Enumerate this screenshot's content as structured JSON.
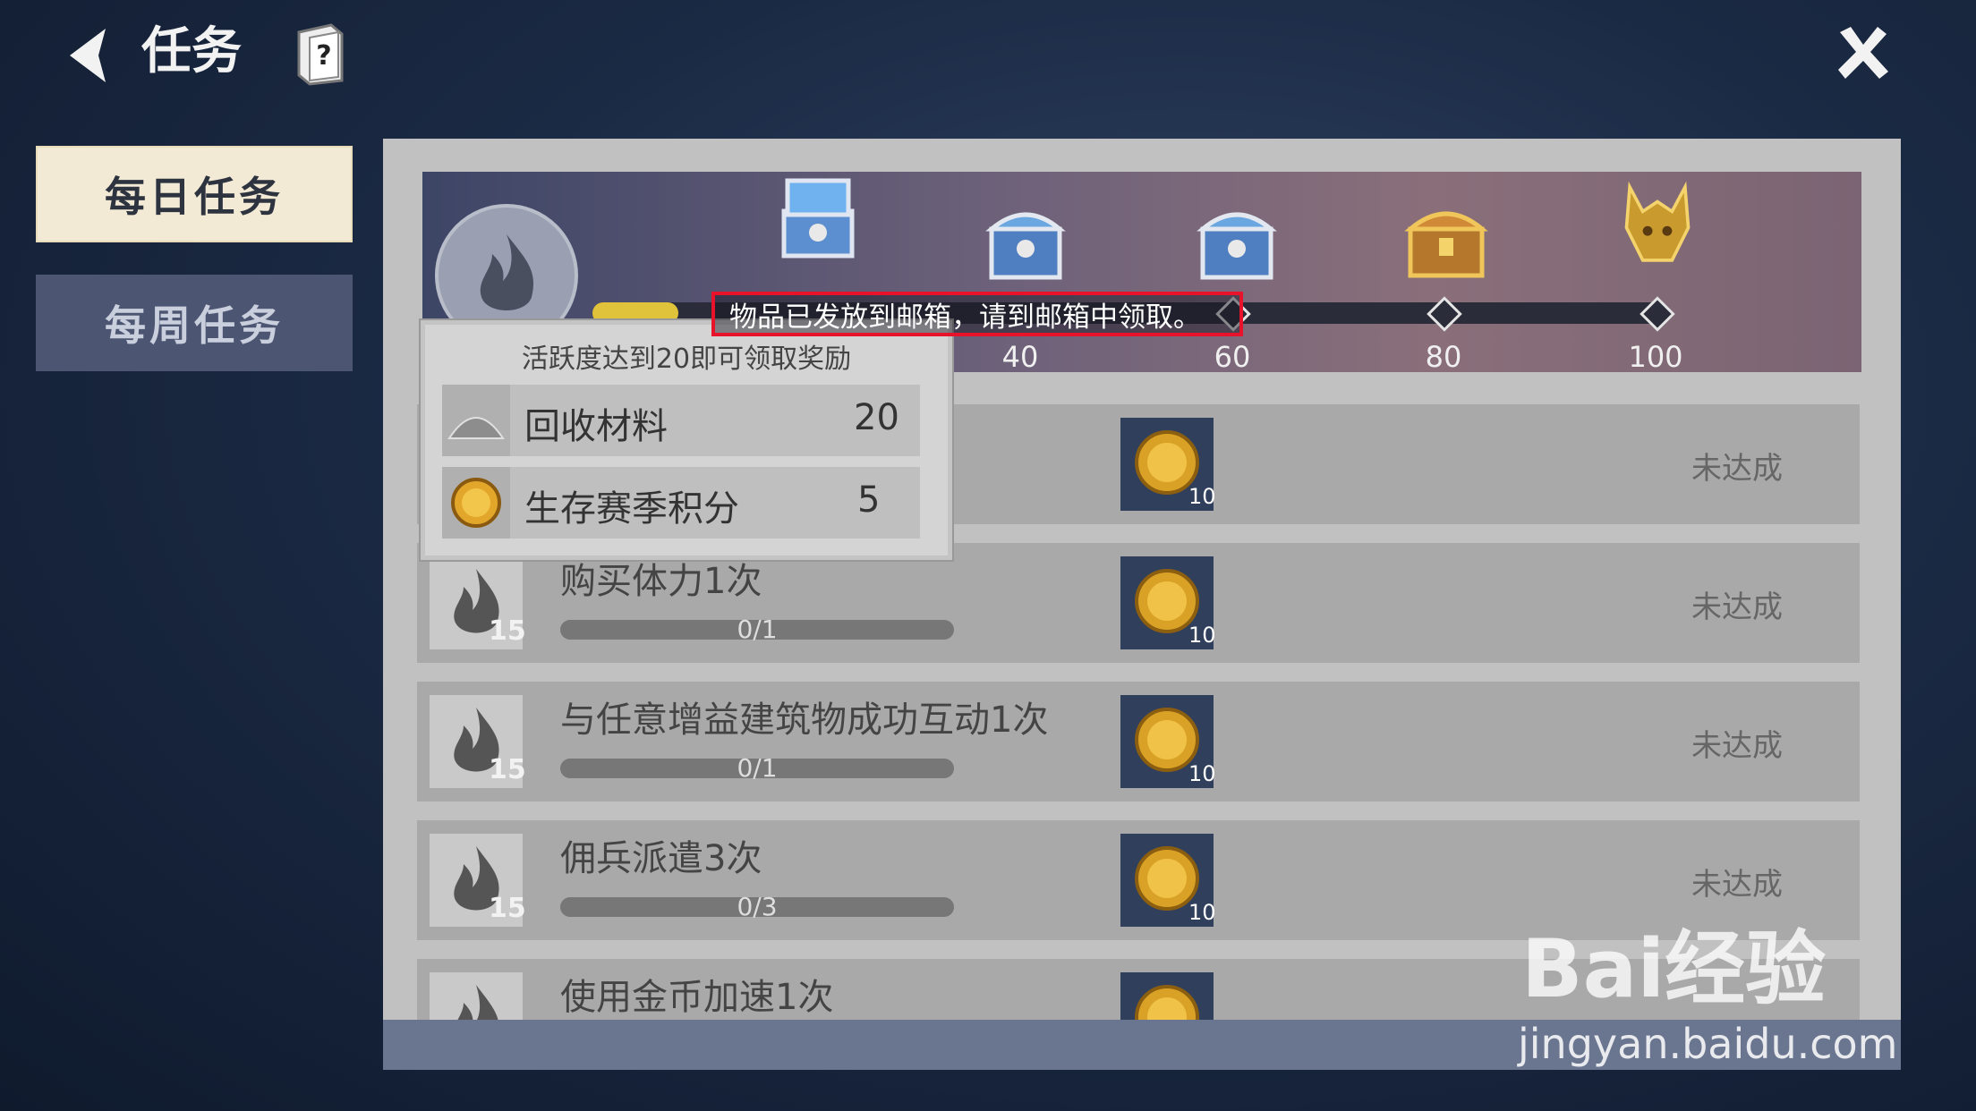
{
  "header": {
    "title": "任务"
  },
  "tabs": [
    {
      "label": "每日任务",
      "active": true
    },
    {
      "label": "每周任务",
      "active": false
    }
  ],
  "activity": {
    "progress_fraction": 0.08,
    "milestones": [
      "40",
      "60",
      "80",
      "100"
    ]
  },
  "notice": "物品已发放到邮箱，请到邮箱中领取。",
  "popup": {
    "title": "活跃度达到20即可领取奖励",
    "items": [
      {
        "label": "回收材料",
        "value": "20",
        "icon": "material-pile-icon"
      },
      {
        "label": "生存赛季积分",
        "value": "5",
        "icon": "season-coin-icon"
      }
    ]
  },
  "tasks": [
    {
      "name": "",
      "points": "",
      "progress": "",
      "reward": "10",
      "status": "未达成"
    },
    {
      "name": "购买体力1次",
      "points": "15",
      "progress": "0/1",
      "reward": "10",
      "status": "未达成"
    },
    {
      "name": "与任意增益建筑物成功互动1次",
      "points": "15",
      "progress": "0/1",
      "reward": "10",
      "status": "未达成"
    },
    {
      "name": "佣兵派遣3次",
      "points": "15",
      "progress": "0/3",
      "reward": "10",
      "status": "未达成"
    },
    {
      "name": "使用金币加速1次",
      "points": "",
      "progress": "",
      "reward": "",
      "status": ""
    }
  ],
  "watermark": {
    "brand": "Bai经验",
    "url": "jingyan.baidu.com"
  },
  "colors": {
    "accent_gold": "#e1c33b",
    "notice_border": "#e8132b",
    "active_tab": "#f2ead5"
  }
}
